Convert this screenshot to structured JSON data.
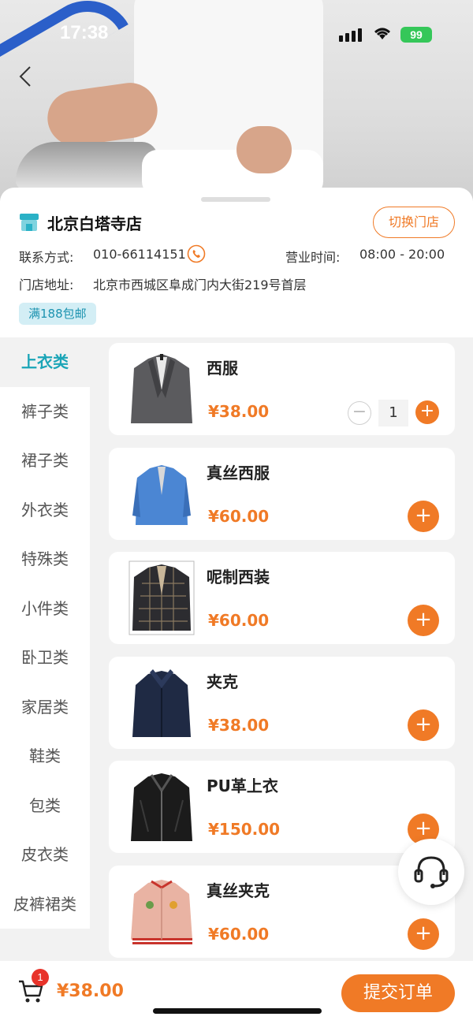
{
  "status": {
    "time": "17:38",
    "battery": "99"
  },
  "store": {
    "name": "北京白塔寺店",
    "switch_label": "切换门店",
    "contact_label": "联系方式:",
    "contact_value": "010-66114151",
    "hours_label": "营业时间:",
    "hours_value": "08:00 - 20:00",
    "address_label": "门店地址:",
    "address_value": "北京市西城区阜成门内大街219号首层",
    "free_shipping_tag": "满188包邮"
  },
  "categories": [
    "上衣类",
    "裤子类",
    "裙子类",
    "外衣类",
    "特殊类",
    "小件类",
    "卧卫类",
    "家居类",
    "鞋类",
    "包类",
    "皮衣类",
    "皮裤裙类"
  ],
  "active_category": "上衣类",
  "products": [
    {
      "name": "西服",
      "price": "¥38.00",
      "quantity": "1"
    },
    {
      "name": "真丝西服",
      "price": "¥60.00"
    },
    {
      "name": "呢制西装",
      "price": "¥60.00"
    },
    {
      "name": "夹克",
      "price": "¥38.00"
    },
    {
      "name": "PU革上衣",
      "price": "¥150.00"
    },
    {
      "name": "真丝夹克",
      "price": "¥60.00"
    }
  ],
  "controls": {
    "plus": "+",
    "minus": "−"
  },
  "cart": {
    "badge": "1",
    "total": "¥38.00",
    "submit_label": "提交订单"
  },
  "colors": {
    "accent": "#f07a26",
    "teal": "#1ba5b7",
    "badge_red": "#e8332a"
  },
  "icons": [
    "back-arrow-icon",
    "store-icon",
    "phone-icon",
    "headset-icon",
    "cart-icon"
  ]
}
